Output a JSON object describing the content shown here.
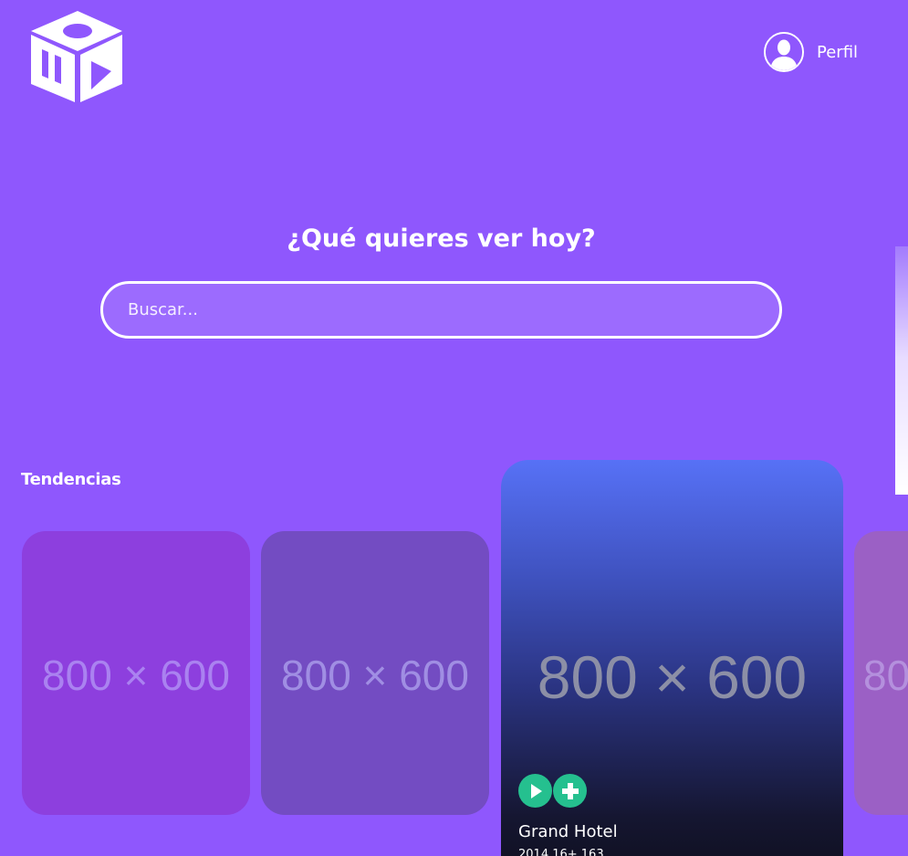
{
  "header": {
    "logo_icon": "cube-play-pause-logo-icon",
    "profile": {
      "avatar_icon": "user-avatar-icon",
      "label": "Perfil"
    }
  },
  "hero": {
    "title": "¿Qué quieres ver hoy?",
    "search": {
      "placeholder": "Buscar...",
      "value": ""
    }
  },
  "trending": {
    "title": "Tendencias",
    "cards": [
      {
        "placeholder": "800 × 600",
        "color": "#8d3fde"
      },
      {
        "placeholder": "800 × 600",
        "color": "#734cc2"
      },
      {
        "placeholder": "800 × 600",
        "featured": true,
        "title": "Grand Hotel",
        "meta": "2014 16+ 163",
        "actions": [
          {
            "icon": "play-icon",
            "color": "#25c08f"
          },
          {
            "icon": "plus-icon",
            "color": "#25c08f"
          }
        ]
      },
      {
        "placeholder": "80",
        "color": "#9b60c5"
      }
    ]
  },
  "colors": {
    "background": "#8f57fd",
    "search_fill": "#9c6bfe",
    "action_green": "#25c08f"
  }
}
